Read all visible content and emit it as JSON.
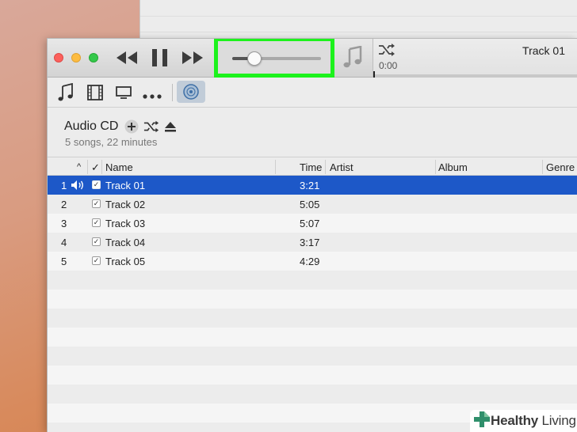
{
  "titlebar": {
    "now_playing": {
      "track": "Track 01",
      "elapsed": "0:00"
    },
    "volume": {
      "level_percent": 25
    }
  },
  "source": {
    "title": "Audio CD",
    "subtitle": "5 songs, 22 minutes"
  },
  "table": {
    "columns": {
      "sort": "^",
      "check": "✓",
      "name": "Name",
      "time": "Time",
      "artist": "Artist",
      "album": "Album",
      "genre": "Genre"
    },
    "rows": [
      {
        "num": "1",
        "name": "Track 01",
        "time": "3:21",
        "playing": true
      },
      {
        "num": "2",
        "name": "Track 02",
        "time": "5:05"
      },
      {
        "num": "3",
        "name": "Track 03",
        "time": "5:07"
      },
      {
        "num": "4",
        "name": "Track 04",
        "time": "3:17"
      },
      {
        "num": "5",
        "name": "Track 05",
        "time": "4:29"
      }
    ]
  },
  "watermark": {
    "brand_a": "Healthy",
    "brand_b": " Living"
  },
  "colors": {
    "highlight": "#1cf21c",
    "selection": "#1d58c8"
  }
}
